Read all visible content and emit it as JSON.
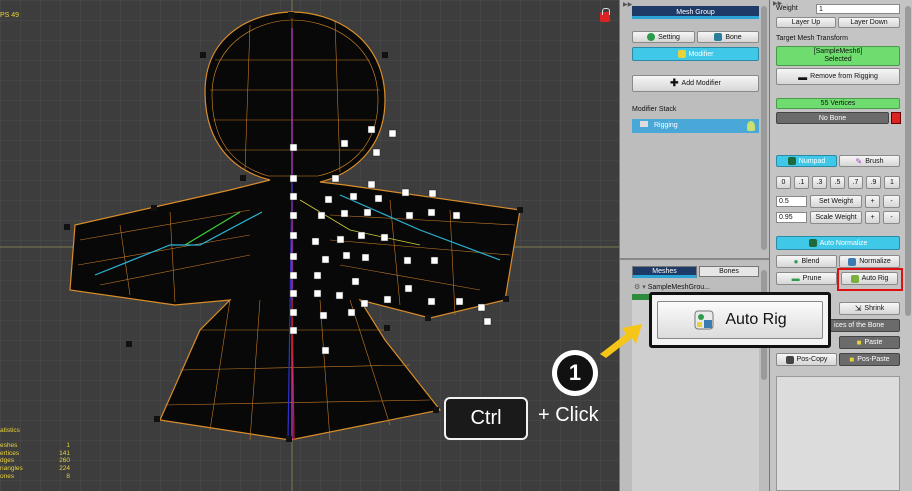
{
  "viewport": {
    "fps": "PS 49",
    "statistics": {
      "title": "atistics",
      "rows": [
        {
          "label": "eshes",
          "value": "1"
        },
        {
          "label": "ertices",
          "value": "141"
        },
        {
          "label": "dges",
          "value": "260"
        },
        {
          "label": "riangles",
          "value": "224"
        },
        {
          "label": "ones",
          "value": "8"
        }
      ]
    }
  },
  "mid_panel": {
    "header": "Mesh Group",
    "setting_label": "Setting",
    "bone_label": "Bone",
    "modifier_label": "Modifier",
    "add_modifier_label": "Add Modifier",
    "modifier_stack_label": "Modifier Stack",
    "stack_items": [
      "Rigging"
    ],
    "tabs": [
      "Meshes",
      "Bones"
    ],
    "tree_items": [
      "SampleMeshGrou..."
    ]
  },
  "right_panel": {
    "weight_label": "Weight",
    "weight_value": "1",
    "layer_up": "Layer Up",
    "layer_down": "Layer Down",
    "target_mesh_label": "Target Mesh Transform",
    "selected_mesh_line1": "[SampleMesh6]",
    "selected_mesh_line2": "Selected",
    "remove_rigging": "Remove from Rigging",
    "vertices_badge": "55 Vertices",
    "no_bone": "No Bone",
    "numpad": "Numpad",
    "brush": "Brush",
    "numpad_values": [
      "0",
      ".1",
      ".3",
      ".5",
      ".7",
      ".9",
      "1"
    ],
    "set_weight_value": "0.5",
    "set_weight": "Set Weight",
    "scale_weight_value": "0.95",
    "scale_weight": "Scale Weight",
    "plus": "+",
    "minus": "-",
    "auto_normalize": "Auto Normalize",
    "blend": "Blend",
    "normalize": "Normalize",
    "prune": "Prune",
    "auto_rig": "Auto Rig",
    "shrink": "Shrink",
    "vertices_of_bone": "ices of the Bone",
    "paste": "Paste",
    "pos_copy": "Pos-Copy",
    "pos_paste": "Pos-Paste"
  },
  "callout": {
    "auto_rig_large": "Auto Rig",
    "step_number": "1",
    "ctrl_key": "Ctrl",
    "plus_click": "+ Click"
  },
  "colors": {
    "header_blue": "#1e3a66",
    "accent_cyan": "#3fc8e8",
    "accent_green": "#6fdc6f",
    "highlight_red": "#e01010",
    "callout_arrow": "#f5c518"
  }
}
